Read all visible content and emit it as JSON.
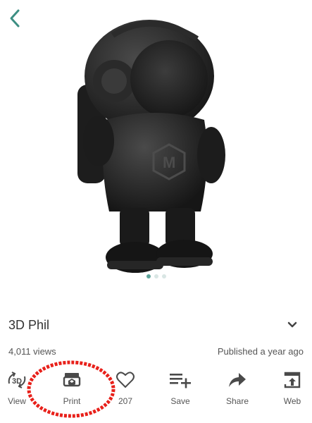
{
  "model": {
    "name": "3D Phil",
    "views": "4,011 views",
    "published": "Published a year ago"
  },
  "carousel": {
    "count": 3,
    "active": 0
  },
  "actions": {
    "view3d": {
      "icon_text": "3D",
      "label": "View"
    },
    "print": {
      "label": "Print"
    },
    "like": {
      "count": "207"
    },
    "save": {
      "label": "Save"
    },
    "share": {
      "label": "Share"
    },
    "web": {
      "label": "Web"
    }
  },
  "icons": {
    "back": "chevron-left-icon",
    "expand": "chevron-down-icon",
    "print": "printer-icon",
    "like": "heart-icon",
    "save": "playlist-add-icon",
    "share": "share-arrow-icon",
    "web": "open-in-web-icon"
  },
  "colors": {
    "accent": "#3d8f83",
    "annotation": "#e8201a",
    "icon": "#4a4a4a"
  }
}
